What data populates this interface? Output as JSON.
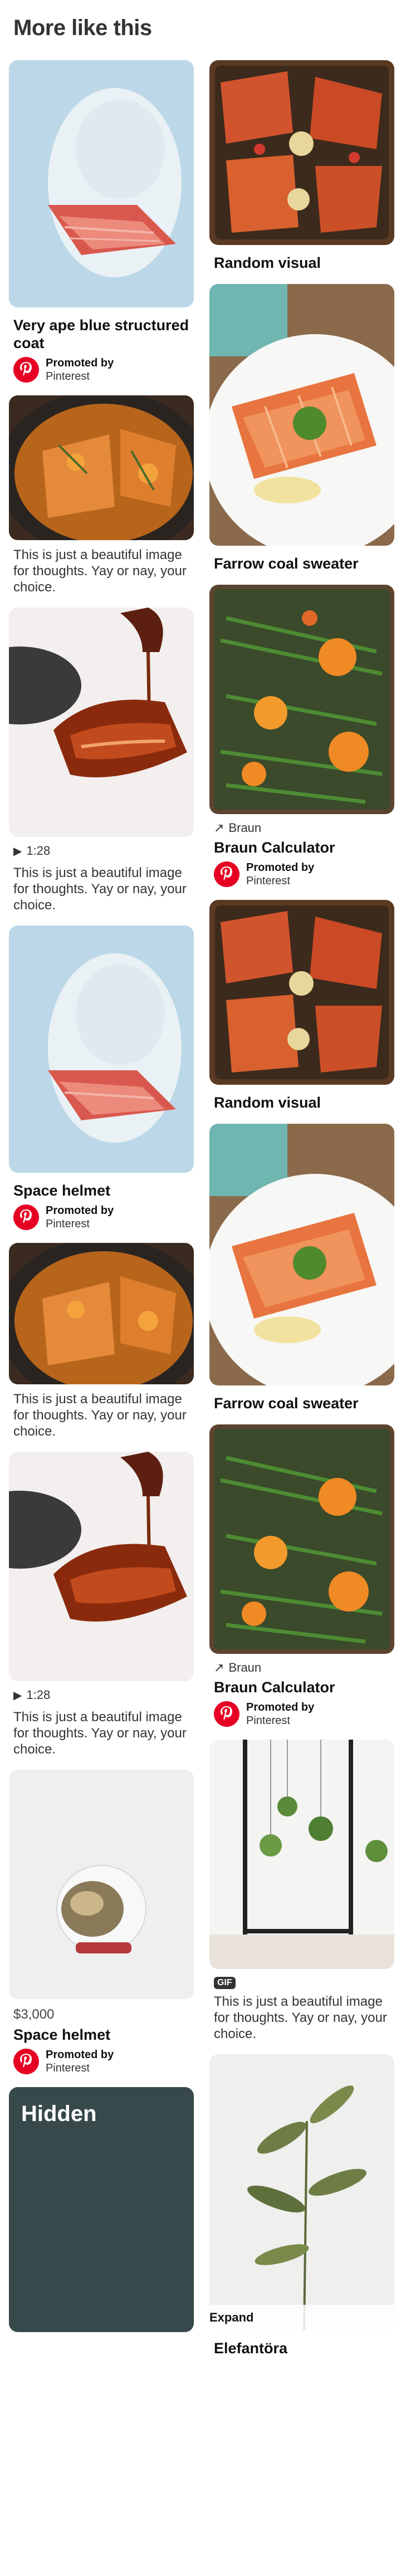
{
  "page": {
    "heading": "More like this"
  },
  "left": [
    {
      "kind": "pin",
      "image": "salt-crusted-salmon",
      "title": "Very ape blue structured coat",
      "promo_line1": "Promoted by",
      "promo_line2": "Pinterest"
    },
    {
      "kind": "pin",
      "image": "salmon-skillet-orange",
      "desc": "This is just a beautiful image for thoughts. Yay or nay, your choice."
    },
    {
      "kind": "video",
      "image": "glazed-salmon",
      "duration": "1:28",
      "desc": "This is just a beautiful image for thoughts. Yay or nay, your choice."
    },
    {
      "kind": "pin",
      "image": "salt-crusted-salmon",
      "title": "Space helmet",
      "promo_line1": "Promoted by",
      "promo_line2": "Pinterest"
    },
    {
      "kind": "pin",
      "image": "salmon-skillet-orange",
      "desc": "This is just a beautiful image for thoughts. Yay or nay, your choice."
    },
    {
      "kind": "video",
      "image": "glazed-salmon",
      "duration": "1:28",
      "desc": "This is just a beautiful image for thoughts. Yay or nay, your choice."
    },
    {
      "kind": "product",
      "image": "space-helmet",
      "price": "$3,000",
      "title": "Space helmet",
      "promo_line1": "Promoted by",
      "promo_line2": "Pinterest"
    },
    {
      "kind": "hidden",
      "label": "Hidden"
    }
  ],
  "right": [
    {
      "kind": "pin",
      "image": "salmon-potatoes",
      "title": "Random visual"
    },
    {
      "kind": "pin",
      "image": "salmon-plate-herbs",
      "title": "Farrow coal sweater"
    },
    {
      "kind": "link",
      "image": "green-beans-oranges",
      "domain": "Braun",
      "title": "Braun Calculator",
      "promo_line1": "Promoted by",
      "promo_line2": "Pinterest"
    },
    {
      "kind": "pin",
      "image": "salmon-potatoes",
      "title": "Random visual"
    },
    {
      "kind": "pin",
      "image": "salmon-plate-herbs",
      "title": "Farrow coal sweater"
    },
    {
      "kind": "link",
      "image": "green-beans-oranges",
      "domain": "Braun",
      "title": "Braun Calculator",
      "promo_line1": "Promoted by",
      "promo_line2": "Pinterest"
    },
    {
      "kind": "gif",
      "image": "hanging-plants",
      "badge": "GIF",
      "desc": "This is just a beautiful image for thoughts. Yay or nay, your choice."
    },
    {
      "kind": "expand",
      "image": "potted-plant",
      "badge": "Expand",
      "title": "Elefantöra"
    }
  ],
  "colors": {
    "pinterest_red": "#e60023",
    "hidden_bg": "#37494a"
  }
}
